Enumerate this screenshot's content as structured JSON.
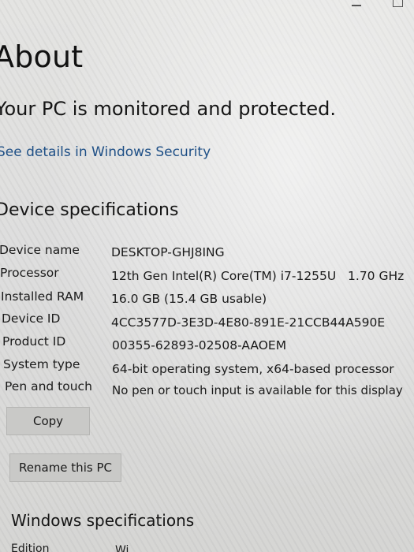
{
  "page": {
    "title": "About",
    "protection_status": "Your PC is monitored and protected.",
    "security_link": "See details in Windows Security"
  },
  "device_specifications": {
    "title": "Device specifications",
    "rows": [
      {
        "label": "Device name",
        "value": "DESKTOP-GHJ8ING"
      },
      {
        "label": "Processor",
        "value": "12th Gen Intel(R) Core(TM) i7-1255U   1.70 GHz"
      },
      {
        "label": "Installed RAM",
        "value": "16.0 GB (15.4 GB usable)"
      },
      {
        "label": "Device ID",
        "value": "4CC3577D-3E3D-4E80-891E-21CCB44A590E"
      },
      {
        "label": "Product ID",
        "value": "00355-62893-02508-AAOEM"
      },
      {
        "label": "System type",
        "value": "64-bit operating system, x64-based processor"
      },
      {
        "label": "Pen and touch",
        "value": "No pen or touch input is available for this display"
      }
    ],
    "copy_label": "Copy",
    "rename_label": "Rename this PC"
  },
  "windows_specifications": {
    "title": "Windows specifications",
    "first_row_label": "Edition",
    "first_row_value": "Wi"
  },
  "icons": {
    "minimize": "minimize-icon",
    "maximize": "maximize-icon"
  },
  "colors": {
    "link": "#1e4f86",
    "button": "#c9c9c7"
  }
}
